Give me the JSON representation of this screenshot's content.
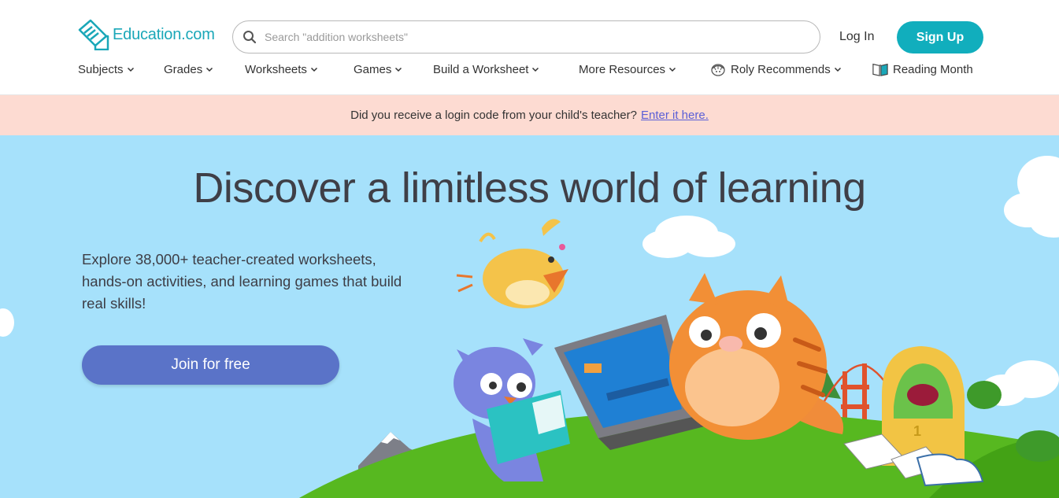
{
  "brand": {
    "name": "Education.com",
    "color": "#1aa7b8"
  },
  "search": {
    "placeholder": "Search \"addition worksheets\""
  },
  "auth": {
    "login_label": "Log In",
    "signup_label": "Sign Up"
  },
  "nav": {
    "items": [
      {
        "label": "Subjects"
      },
      {
        "label": "Grades"
      },
      {
        "label": "Worksheets"
      },
      {
        "label": "Games"
      },
      {
        "label": "Build a Worksheet"
      },
      {
        "label": "More Resources"
      },
      {
        "label": "Roly Recommends",
        "icon": "roly-icon"
      },
      {
        "label": "Reading Month",
        "icon": "book-icon"
      }
    ]
  },
  "banner": {
    "text": "Did you receive a login code from your child's teacher?",
    "link_label": "Enter it here."
  },
  "hero": {
    "title": "Discover a limitless world of learning",
    "description": "Explore 38,000+ teacher-created worksheets, hands-on activities, and learning games that build real skills!",
    "cta_label": "Join for free",
    "illustration": "learning-characters-illustration"
  },
  "colors": {
    "accent": "#11aebd",
    "cta": "#5a73c8",
    "banner_bg": "#fddbd2",
    "hero_bg": "#a6e1fb",
    "link": "#5a5fd6"
  }
}
